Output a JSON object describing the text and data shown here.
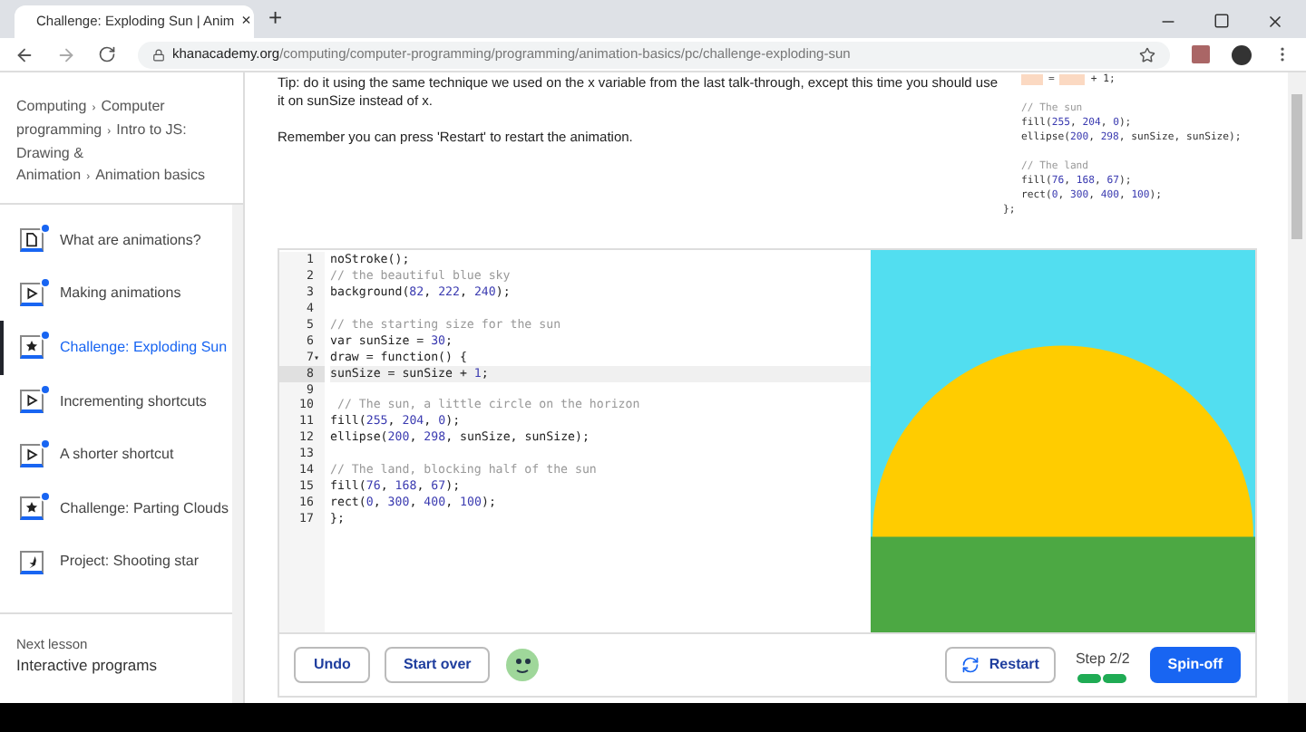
{
  "browser": {
    "tab_title": "Challenge: Exploding Sun | Anim",
    "tab_close": "×",
    "new_tab": "+",
    "url_domain": "khanacademy.org",
    "url_path": "/computing/computer-programming/programming/animation-basics/pc/challenge-exploding-sun"
  },
  "sidebar": {
    "breadcrumb_separator": "›",
    "breadcrumb": [
      "Computing",
      "Computer programming",
      "Intro to JS: Drawing & Animation",
      "Animation basics"
    ],
    "items": [
      {
        "label": "What are animations?",
        "kind": "article",
        "completed": true,
        "selected": false
      },
      {
        "label": "Making animations",
        "kind": "video",
        "completed": true,
        "selected": false
      },
      {
        "label": "Challenge: Exploding Sun",
        "kind": "challenge",
        "completed": true,
        "selected": true
      },
      {
        "label": "Incrementing shortcuts",
        "kind": "video",
        "completed": true,
        "selected": false
      },
      {
        "label": "A shorter shortcut",
        "kind": "video",
        "completed": true,
        "selected": false
      },
      {
        "label": "Challenge: Parting Clouds",
        "kind": "challenge",
        "completed": true,
        "selected": false
      },
      {
        "label": "Project: Shooting star",
        "kind": "project",
        "completed": false,
        "selected": false
      }
    ],
    "next_lesson_label": "Next lesson",
    "next_lesson": "Interactive programs"
  },
  "instructions": [
    "Tip: do it using the same technique we used on the x variable from the last talk-through, except this time you should use it on sunSize instead of x.",
    "Remember you can press 'Restart' to restart the animation."
  ],
  "hint_code": {
    "blank_line": [
      "=",
      "+ 1;"
    ],
    "blocks": [
      [
        "// The sun",
        "fill(255, 204, 0);",
        "ellipse(200, 298, sunSize, sunSize);"
      ],
      [
        "// The land",
        "fill(76, 168, 67);",
        "rect(0, 300, 400, 100);"
      ]
    ],
    "closing": "};"
  },
  "editor": {
    "fold_marker": "▾",
    "lines": [
      {
        "number": "1",
        "text": "noStroke();",
        "active": false,
        "foldable": false
      },
      {
        "number": "2",
        "text": "// the beautiful blue sky",
        "active": false,
        "foldable": false
      },
      {
        "number": "3",
        "text": "background(82, 222, 240);",
        "active": false,
        "foldable": false
      },
      {
        "number": "4",
        "active": false,
        "foldable": false
      },
      {
        "number": "5",
        "text": "// the starting size for the sun",
        "active": false,
        "foldable": false
      },
      {
        "number": "6",
        "text": "var sunSize = 30;",
        "active": false,
        "foldable": false
      },
      {
        "number": "7",
        "text": "draw = function() {",
        "active": false,
        "foldable": true
      },
      {
        "number": "8",
        "text": "sunSize = sunSize + 1;",
        "active": true,
        "foldable": false
      },
      {
        "number": "9",
        "active": false,
        "foldable": false
      },
      {
        "number": "10",
        "text": " // The sun, a little circle on the horizon",
        "active": false,
        "foldable": false
      },
      {
        "number": "11",
        "text": "fill(255, 204, 0);",
        "active": false,
        "foldable": false
      },
      {
        "number": "12",
        "text": "ellipse(200, 298, sunSize, sunSize);",
        "active": false,
        "foldable": false
      },
      {
        "number": "13",
        "active": false,
        "foldable": false
      },
      {
        "number": "14",
        "text": "// The land, blocking half of the sun",
        "active": false,
        "foldable": false
      },
      {
        "number": "15",
        "text": "fill(76, 168, 67);",
        "active": false,
        "foldable": false
      },
      {
        "number": "16",
        "text": "rect(0, 300, 400, 100);",
        "active": false,
        "foldable": false
      },
      {
        "number": "17",
        "text": "};",
        "active": false,
        "foldable": false
      }
    ]
  },
  "toolbar": {
    "undo": "Undo",
    "start_over": "Start over",
    "restart": "Restart",
    "step": "Step 2/2",
    "steps": [
      {
        "done": true
      },
      {
        "done": true
      }
    ],
    "spin_off": "Spin-off"
  }
}
